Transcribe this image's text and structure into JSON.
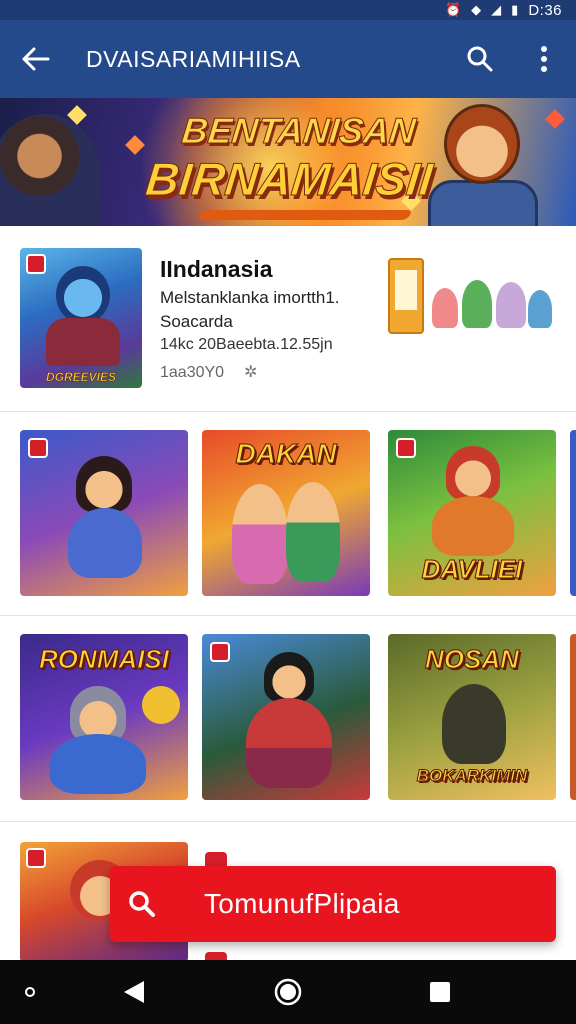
{
  "status_bar": {
    "time": "D:36",
    "icons": [
      "alarm-icon",
      "wifi-icon",
      "signal-icon",
      "battery-icon"
    ]
  },
  "app_bar": {
    "title": "DVAISARIAMIHIISA",
    "back_icon": "arrow-left-icon",
    "search_icon": "search-icon",
    "menu_icon": "more-vert-icon"
  },
  "banner": {
    "line1": "BENTANISAN",
    "line2": "BIRNAMAISII"
  },
  "featured": {
    "title": "IIndanasia",
    "subtitle": "Melstanklanka imortth1.",
    "subtitle2": "Soacarda",
    "meta": "14kc 20Baeebta.12.55jn",
    "count": "1aa30Y0",
    "star_icon": "star-icon",
    "thumb_label": "DGREEVIES"
  },
  "row1": {
    "tiles": [
      {
        "label": "",
        "colors": [
          "#3a5ac8",
          "#8a4ab8",
          "#f0a040"
        ]
      },
      {
        "label": "DAKAN",
        "colors": [
          "#e84a2a",
          "#f0a830",
          "#7a3ab8"
        ]
      },
      {
        "label": "DAVLIEI",
        "colors": [
          "#2e8a3a",
          "#7ac040",
          "#f0a040"
        ]
      }
    ]
  },
  "row2": {
    "tiles": [
      {
        "label": "RONMAISI",
        "colors": [
          "#3a2a8a",
          "#6a3ac0",
          "#f0a040"
        ]
      },
      {
        "label": "",
        "colors": [
          "#4a8ad8",
          "#2a5a3a",
          "#c83a3a"
        ]
      },
      {
        "label": "NOSAN",
        "sublabel": "BOKARKIMIN",
        "colors": [
          "#5a6a2a",
          "#9aa040",
          "#f0c060"
        ]
      }
    ]
  },
  "snackbar": {
    "label": "TomunufPlipaia",
    "icon": "search-icon"
  },
  "nav_bar": {
    "icons": [
      "dot-icon",
      "back-triangle-icon",
      "home-circle-icon",
      "recents-square-icon"
    ]
  },
  "colors": {
    "primary": "#254a8c",
    "status": "#1f3b73",
    "accent": "#e8141e",
    "nav": "#0a0a0a"
  }
}
